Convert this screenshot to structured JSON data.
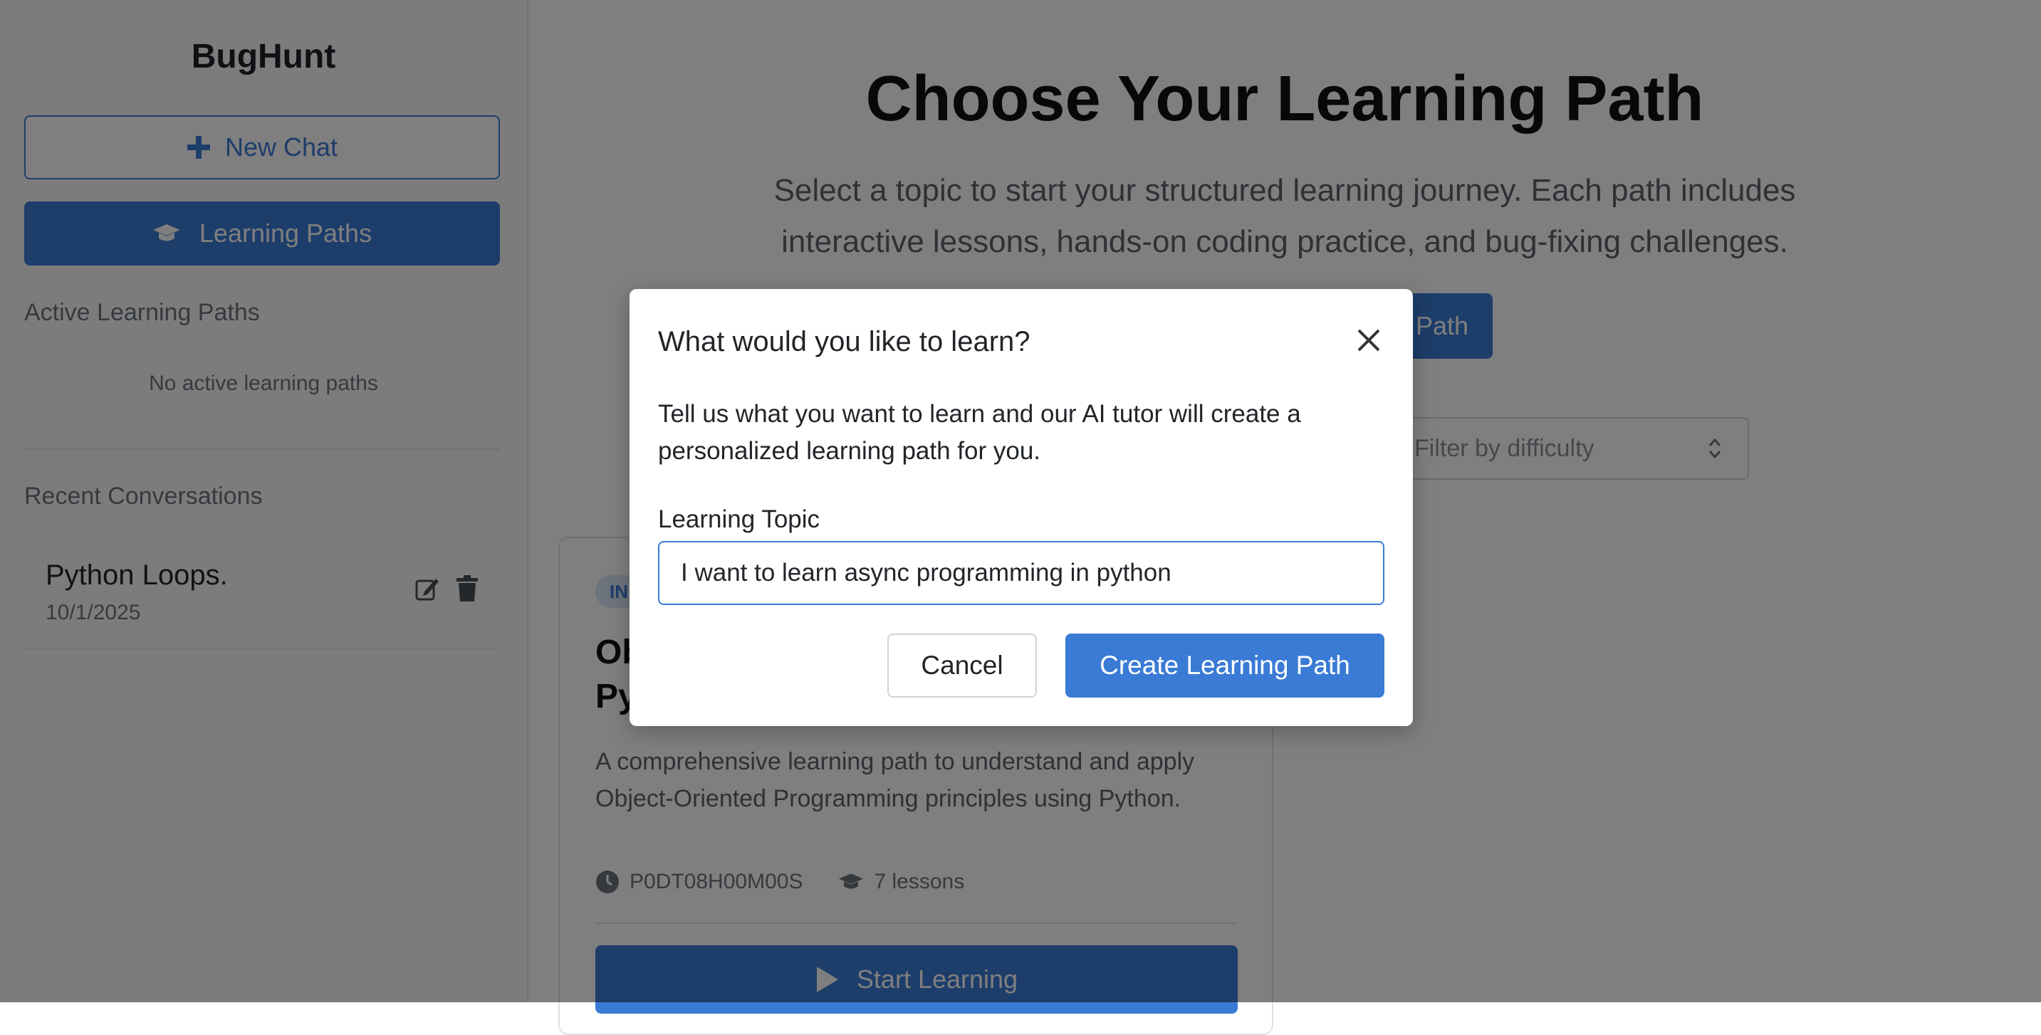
{
  "sidebar": {
    "brand": "BugHunt",
    "new_chat_label": "New Chat",
    "learning_paths_label": "Learning Paths",
    "active_paths_title": "Active Learning Paths",
    "active_paths_empty": "No active learning paths",
    "recent_title": "Recent Conversations",
    "conversations": [
      {
        "title": "Python Loops.",
        "date": "10/1/2025"
      }
    ]
  },
  "main": {
    "title": "Choose Your Learning Path",
    "subtitle": "Select a topic to start your structured learning journey. Each path includes interactive lessons, hands-on coding practice, and bug-fixing challenges.",
    "create_button_visible_text": "Path",
    "filter_placeholder": "Filter by difficulty",
    "card": {
      "badge": "IN",
      "title": "Ob\nPy",
      "description": "A comprehensive learning path to understand and apply Object-Oriented Programming principles using Python.",
      "duration": "P0DT08H00M00S",
      "lessons": "7 lessons",
      "start_label": "Start Learning"
    }
  },
  "modal": {
    "title": "What would you like to learn?",
    "description": "Tell us what you want to learn and our AI tutor will create a personalized learning path for you.",
    "field_label": "Learning Topic",
    "input_value": "I want to learn async programming in python",
    "cancel_label": "Cancel",
    "submit_label": "Create Learning Path"
  },
  "colors": {
    "accent": "#3a7bd5",
    "backdrop": "rgba(0,0,0,0.5)"
  }
}
